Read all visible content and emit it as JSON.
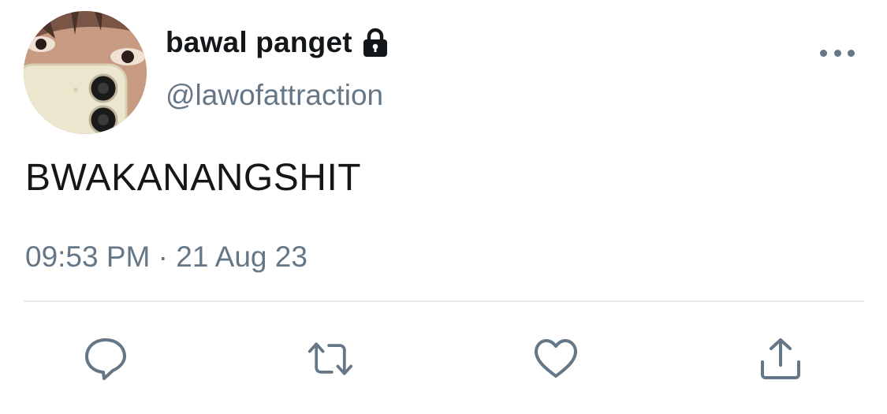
{
  "tweet": {
    "display_name": "bawal panget",
    "handle": "@lawofattraction",
    "text": "BWAKANANGSHIT",
    "timestamp": "09:53 PM · 21 Aug 23",
    "protected_icon": "lock-icon",
    "more_icon": "more-horizontal-icon"
  },
  "actions": [
    {
      "name": "reply",
      "icon": "reply-icon"
    },
    {
      "name": "retweet",
      "icon": "retweet-icon"
    },
    {
      "name": "like",
      "icon": "heart-icon"
    },
    {
      "name": "share",
      "icon": "share-icon"
    }
  ],
  "colors": {
    "text_primary": "#14171a",
    "text_secondary": "#657786",
    "divider": "#e6ecf0",
    "background": "#ffffff"
  }
}
